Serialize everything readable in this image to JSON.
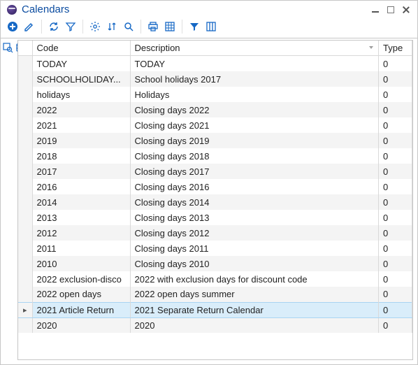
{
  "window": {
    "title": "Calendars"
  },
  "toolbar": {
    "icons": [
      "add",
      "edit",
      "refresh",
      "filter",
      "settings",
      "sort",
      "search",
      "print",
      "grid",
      "funnel-adv",
      "columns"
    ]
  },
  "rail": {
    "items": [
      "inspect",
      "db"
    ]
  },
  "table": {
    "columns": [
      {
        "key": "code",
        "label": "Code"
      },
      {
        "key": "description",
        "label": "Description",
        "sorted": true
      },
      {
        "key": "type",
        "label": "Type"
      }
    ],
    "rows": [
      {
        "code": "TODAY",
        "description": "TODAY",
        "type": "0"
      },
      {
        "code": "SCHOOLHOLIDAY...",
        "description": "School holidays 2017",
        "type": "0"
      },
      {
        "code": "holidays",
        "description": "Holidays",
        "type": "0"
      },
      {
        "code": "2022",
        "description": "Closing days 2022",
        "type": "0"
      },
      {
        "code": "2021",
        "description": "Closing days 2021",
        "type": "0"
      },
      {
        "code": "2019",
        "description": "Closing days 2019",
        "type": "0"
      },
      {
        "code": "2018",
        "description": "Closing days 2018",
        "type": "0"
      },
      {
        "code": "2017",
        "description": "Closing days 2017",
        "type": "0"
      },
      {
        "code": "2016",
        "description": "Closing days 2016",
        "type": "0"
      },
      {
        "code": "2014",
        "description": "Closing days 2014",
        "type": "0"
      },
      {
        "code": "2013",
        "description": "Closing days 2013",
        "type": "0"
      },
      {
        "code": "2012",
        "description": "Closing days 2012",
        "type": "0"
      },
      {
        "code": "2011",
        "description": "Closing days 2011",
        "type": "0"
      },
      {
        "code": "2010",
        "description": "Closing days 2010",
        "type": "0"
      },
      {
        "code": "2022 exclusion-disco",
        "description": "2022 with exclusion days for discount code",
        "type": "0"
      },
      {
        "code": "2022 open days",
        "description": "2022 open days summer",
        "type": "0"
      },
      {
        "code": "2021 Article Return",
        "description": "2021 Separate Return Calendar",
        "type": "0",
        "selected": true
      },
      {
        "code": "2020",
        "description": "2020",
        "type": "0"
      }
    ]
  }
}
